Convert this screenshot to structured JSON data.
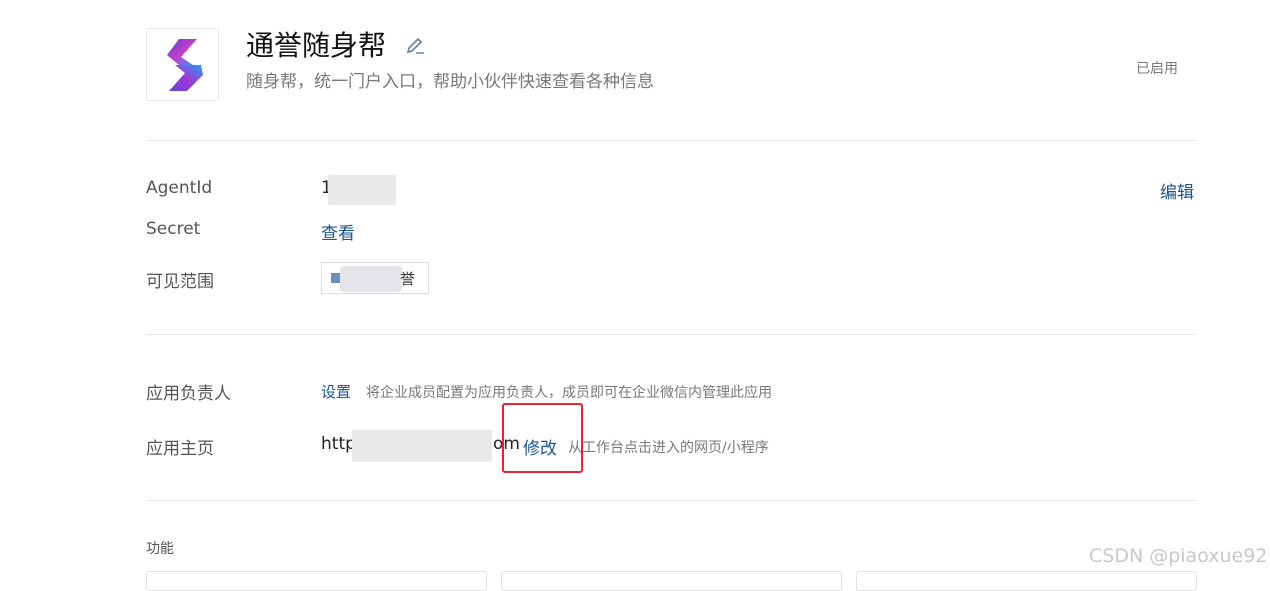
{
  "app": {
    "title": "通誉随身帮",
    "description": "随身帮，统一门户入口，帮助小伙伴快速查看各种信息",
    "status": "已启用"
  },
  "details": {
    "agentid_label": "AgentId",
    "agentid_value_prefix": "1",
    "edit_label": "编辑",
    "secret_label": "Secret",
    "secret_view_label": "查看",
    "scope_label": "可见范围",
    "scope_tag_text": "誉"
  },
  "management": {
    "owner_label": "应用负责人",
    "owner_set_label": "设置",
    "owner_hint": "将企业成员配置为应用负责人，成员即可在企业微信内管理此应用",
    "homepage_label": "应用主页",
    "homepage_url_start": "http",
    "homepage_url_end": "om",
    "homepage_modify_label": "修改",
    "homepage_hint": "从工作台点击进入的网页/小程序"
  },
  "functions": {
    "title": "功能"
  },
  "watermark": "CSDN @piaoxue92",
  "colors": {
    "link": "#1a5692",
    "highlight_box": "#e6252e",
    "muted_text": "#787878"
  },
  "icons": {
    "app_logo": "app-logo-icon",
    "edit": "pencil-icon",
    "scope": "department-icon"
  }
}
